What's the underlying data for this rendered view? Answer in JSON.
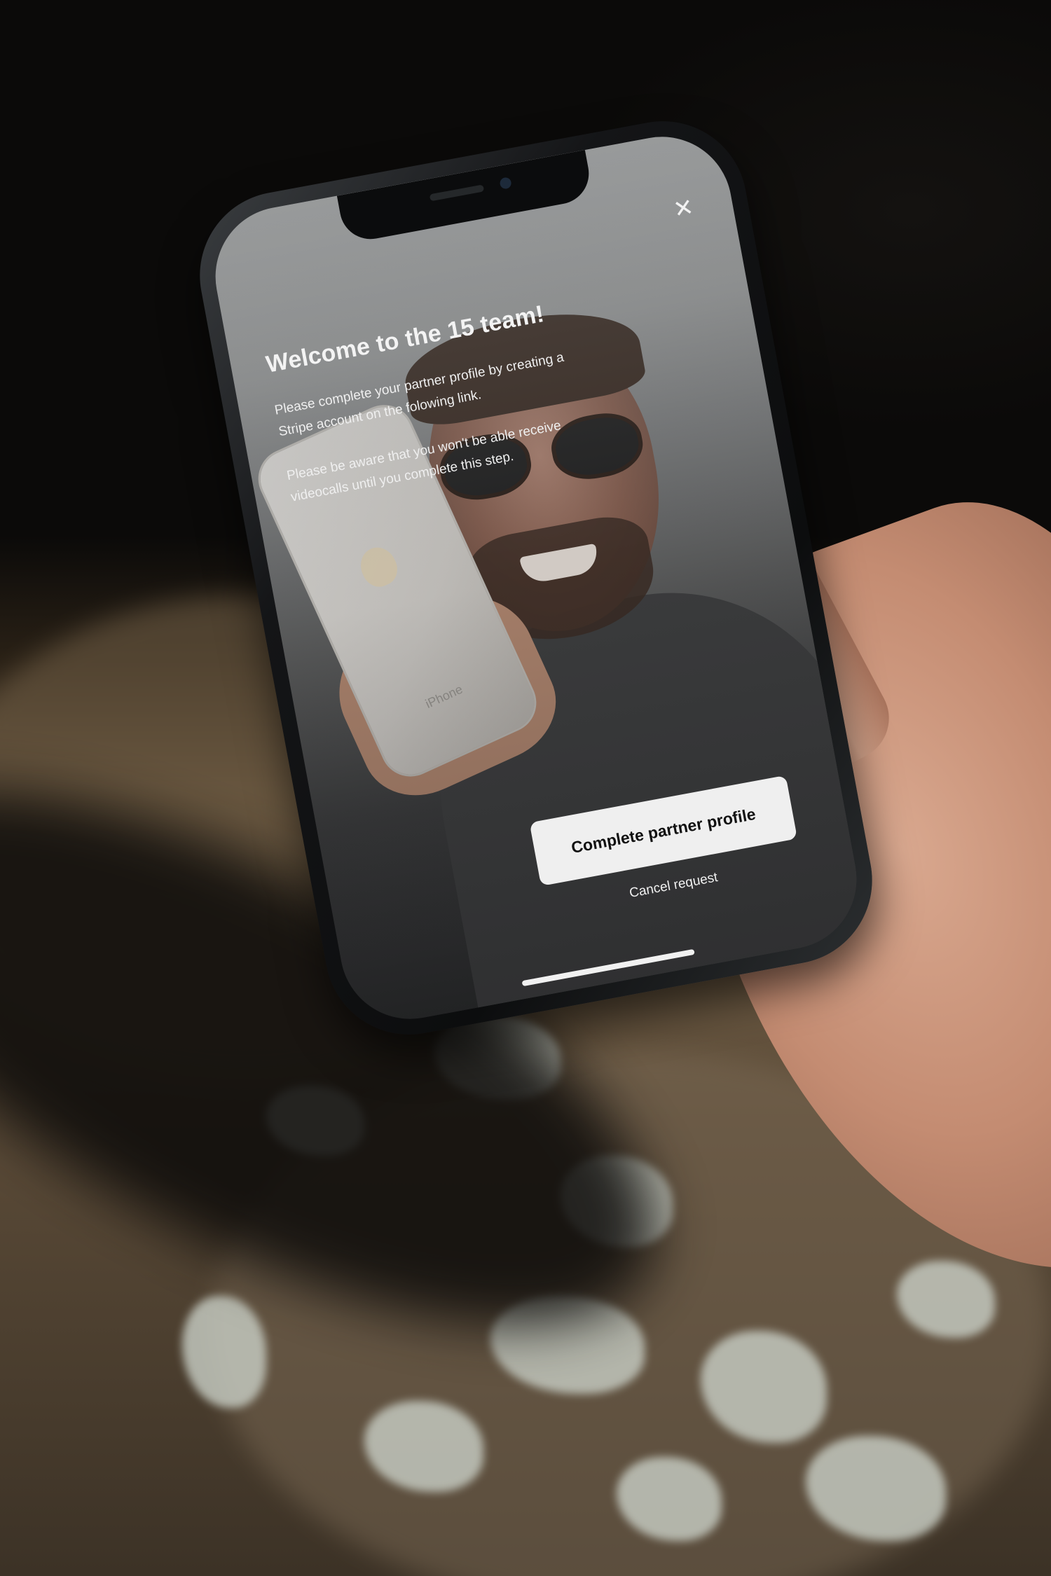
{
  "modal": {
    "close_icon": "close-icon",
    "title": "Welcome to the 15 team!",
    "paragraph_1": "Please complete your partner profile by creating a Stripe account on the folowing link.",
    "paragraph_2": "Please be aware that you won't be able receive videocalls until you complete this step.",
    "primary_button_label": "Complete partner profile",
    "cancel_label": "Cancel request"
  },
  "background_photo": {
    "device_label": "iPhone"
  },
  "colors": {
    "button_background": "#efefef",
    "button_text": "#111111",
    "text": "#f3f3f3"
  }
}
